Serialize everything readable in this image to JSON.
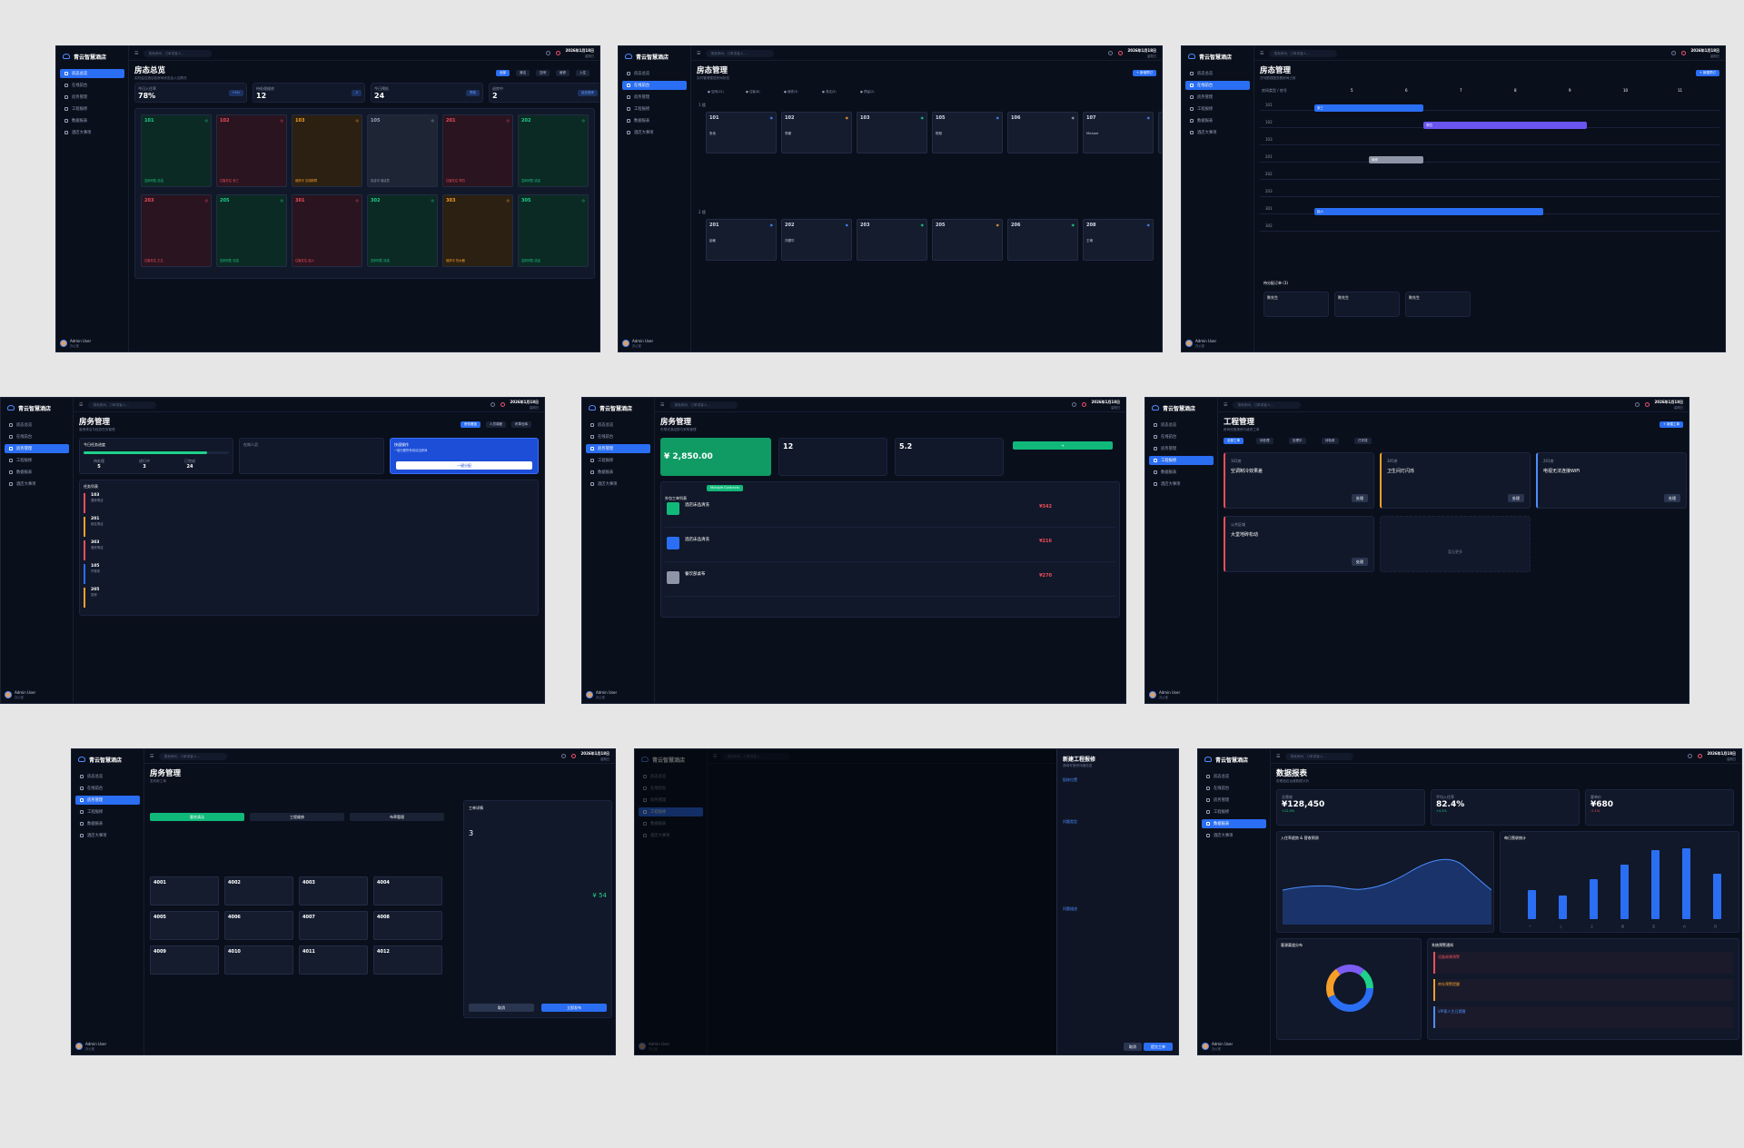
{
  "app": {
    "name": "青云智慧酒店",
    "search_placeholder": "搜索房间、订单或客人...",
    "date": "2026年1月18日",
    "weekday": "星期日",
    "user": "Admin User",
    "role": "办公室"
  },
  "nav": [
    "房态总览",
    "在线前台",
    "房务管理",
    "工程报修",
    "数据报表",
    "酒店大事项"
  ],
  "s1": {
    "title": "房态总览",
    "sub": "实时监控酒店各房间状态及入住情况",
    "filters": [
      "全部",
      "清洁",
      "空闲",
      "维修",
      "入住"
    ],
    "stats": [
      {
        "label": "今日入住率",
        "value": "78%",
        "badge": "+5%"
      },
      {
        "label": "待处理维修",
        "value": "12",
        "badge": "-3"
      },
      {
        "label": "今日预抵",
        "value": "24",
        "badge": "预抵"
      },
      {
        "label": "退房中",
        "value": "2",
        "badge": "延迟退房"
      }
    ],
    "rooms": [
      {
        "n": "101",
        "s": "空闲可售\n清洁",
        "c": "g"
      },
      {
        "n": "102",
        "s": "住客在住\n张三",
        "c": "r"
      },
      {
        "n": "103",
        "s": "维修中\n空调故障",
        "c": "o"
      },
      {
        "n": "105",
        "s": "清洁中\n保洁员",
        "c": "y"
      },
      {
        "n": "201",
        "s": "住客在住\n李四",
        "c": "r"
      },
      {
        "n": "202",
        "s": "空闲可售\n清洁",
        "c": "g"
      },
      {
        "n": "203",
        "s": "住客在住\n王五",
        "c": "r"
      },
      {
        "n": "205",
        "s": "空闲可售\n清洁",
        "c": "g"
      },
      {
        "n": "301",
        "s": "住客在住\n赵六",
        "c": "r"
      },
      {
        "n": "302",
        "s": "空闲可售\n清洁",
        "c": "g"
      },
      {
        "n": "303",
        "s": "维修中\n热水器",
        "c": "o"
      },
      {
        "n": "305",
        "s": "空闲可售\n清洁",
        "c": "g"
      }
    ]
  },
  "s2": {
    "title": "房态管理",
    "sub": "实时管理楼层房间状态",
    "add": "+ 新增预订",
    "legend": [
      "空闲(12)",
      "住客(8)",
      "维修(3)",
      "清洁(5)",
      "预留(2)"
    ],
    "floor1": "1 楼",
    "floor2": "2 楼",
    "f1": [
      {
        "n": "101",
        "g": "张伟",
        "t": "住客"
      },
      {
        "n": "102",
        "g": "李娜",
        "t": "维修"
      },
      {
        "n": "103",
        "g": "",
        "t": "空闲"
      },
      {
        "n": "105",
        "g": "陈默",
        "t": "住客"
      },
      {
        "n": "106",
        "g": "",
        "t": "清洁"
      },
      {
        "n": "107",
        "g": "Michael",
        "t": "住客"
      },
      {
        "n": "108",
        "g": "",
        "t": "空闲"
      }
    ],
    "f2": [
      {
        "n": "201",
        "g": "赵敏",
        "t": "住客"
      },
      {
        "n": "202",
        "g": "刘德华",
        "t": "住客"
      },
      {
        "n": "203",
        "g": "",
        "t": "空闲"
      },
      {
        "n": "205",
        "g": "",
        "t": "维修"
      },
      {
        "n": "206",
        "g": "",
        "t": "空闲"
      },
      {
        "n": "208",
        "g": "王琳",
        "t": "住客"
      }
    ]
  },
  "s3": {
    "title": "房态管理",
    "sub": "甘特图视图查看房间占用",
    "col": "房间类型 / 房号",
    "days": [
      "5",
      "6",
      "7",
      "8",
      "9",
      "10",
      "11"
    ],
    "rooms": [
      "101",
      "102",
      "103",
      "201",
      "202",
      "203",
      "301",
      "302"
    ],
    "bars": [
      {
        "r": 0,
        "d": 0,
        "l": 2,
        "c": "#2a6ef3",
        "t": "张三"
      },
      {
        "r": 1,
        "d": 2,
        "l": 3,
        "c": "#6a55f0",
        "t": "李四"
      },
      {
        "r": 3,
        "d": 1,
        "l": 1,
        "c": "#8d95a6",
        "t": "维修"
      },
      {
        "r": 6,
        "d": 0,
        "l": 4.2,
        "c": "#2a6ef3",
        "t": "赵六"
      }
    ],
    "pending": "待分配订单 (3)",
    "orders": [
      "陈先生",
      "陈先生",
      "陈先生"
    ]
  },
  "s4": {
    "title": "房务管理",
    "sub": "客房清洁与检查任务管理",
    "tabs": [
      "房务看板",
      "人员调度",
      "布草仓库"
    ],
    "progress_title": "今日任务进度",
    "progress": 0.85,
    "kpis": [
      {
        "l": "待处理",
        "v": "5"
      },
      {
        "l": "进行中",
        "v": "3"
      },
      {
        "l": "已完成",
        "v": "24"
      }
    ],
    "staff": "在岗人员",
    "action": "快速操作",
    "action_sub": "一键分配所有待清洁房间",
    "action_btn": "一键分配",
    "list_title": "任务列表",
    "rows": [
      {
        "n": "103",
        "t": "退房清洁"
      },
      {
        "n": "201",
        "t": "续住清洁"
      },
      {
        "n": "303",
        "t": "退房清洁"
      },
      {
        "n": "105",
        "t": "开夜床"
      },
      {
        "n": "205",
        "t": "查房"
      }
    ]
  },
  "s5": {
    "title": "房务管理",
    "sub": "布草洗涤结算与采购管理",
    "total": "¥ 2,850.00",
    "k2": "12",
    "k3": "5.2",
    "list": "外包工单列表",
    "badge": "Multiple Contracts",
    "items": [
      {
        "t": "酒店床品清洗",
        "p": "¥342"
      },
      {
        "t": "酒店床品清洗",
        "p": "¥216"
      },
      {
        "t": "餐饮部桌布",
        "p": "¥270"
      }
    ]
  },
  "s6": {
    "title": "工程管理",
    "sub": "房间设施报修与维修工单",
    "new": "+ 新建工单",
    "tabs": [
      "全部工单",
      "待处理",
      "处理中",
      "待验收",
      "已完成"
    ],
    "orders": [
      {
        "r": "102房",
        "t": "空调制冷效果差",
        "c": "#ef4e5c"
      },
      {
        "r": "305房",
        "t": "卫生间灯闪烁",
        "c": "#f59f2a"
      },
      {
        "r": "201房",
        "t": "电视无法连接WiFi",
        "c": "#4d8dff"
      },
      {
        "r": "公共区域",
        "t": "大堂地砖松动",
        "c": "#ef4e5c"
      }
    ],
    "empty": "暂无更多"
  },
  "s7": {
    "title": "房务管理",
    "sub": "发布新工单",
    "back": "发布新工单",
    "tabs": [
      "客房清洁",
      "工程维修",
      "布草管理"
    ],
    "rooms": [
      "4001",
      "4002",
      "4003",
      "4004",
      "4005",
      "4006",
      "4007",
      "4008",
      "4009",
      "4010",
      "4011",
      "4012"
    ],
    "detail": "工单详情",
    "qty": "3",
    "pay": "预计金额",
    "amt": "¥ 54",
    "cancel": "取消",
    "submit": "立即发布"
  },
  "s8": {
    "title": "新建工程报修",
    "sub": "请填写报修详细信息",
    "loc": "报修位置",
    "type": "问题类型",
    "desc": "问题描述",
    "cancel": "取消",
    "submit": "提交工单"
  },
  "s9": {
    "title": "数据报表",
    "sub": "查看酒店运营数据分析",
    "k": [
      {
        "l": "总营收",
        "v": "¥128,450",
        "d": "+12.5%"
      },
      {
        "l": "平均入住率",
        "v": "82.4%",
        "d": "+4.2%"
      },
      {
        "l": "客单价",
        "v": "¥680",
        "d": "-2.1%"
      }
    ],
    "c1": "入住率趋势 & 营收预测",
    "c2": "每日营收统计",
    "c3": "客源渠道分布",
    "c4": "系统预警通知",
    "bars": [
      0.4,
      0.32,
      0.55,
      0.75,
      0.95,
      0.98,
      0.62
    ],
    "bar_labels": [
      "一",
      "二",
      "三",
      "四",
      "五",
      "六",
      "日"
    ],
    "alerts": [
      "设备故障预警",
      "库存预警提醒",
      "VIP客人生日提醒"
    ],
    "legend": [
      "Ctrip",
      "Direct",
      "OTA",
      "Walk-in"
    ]
  }
}
